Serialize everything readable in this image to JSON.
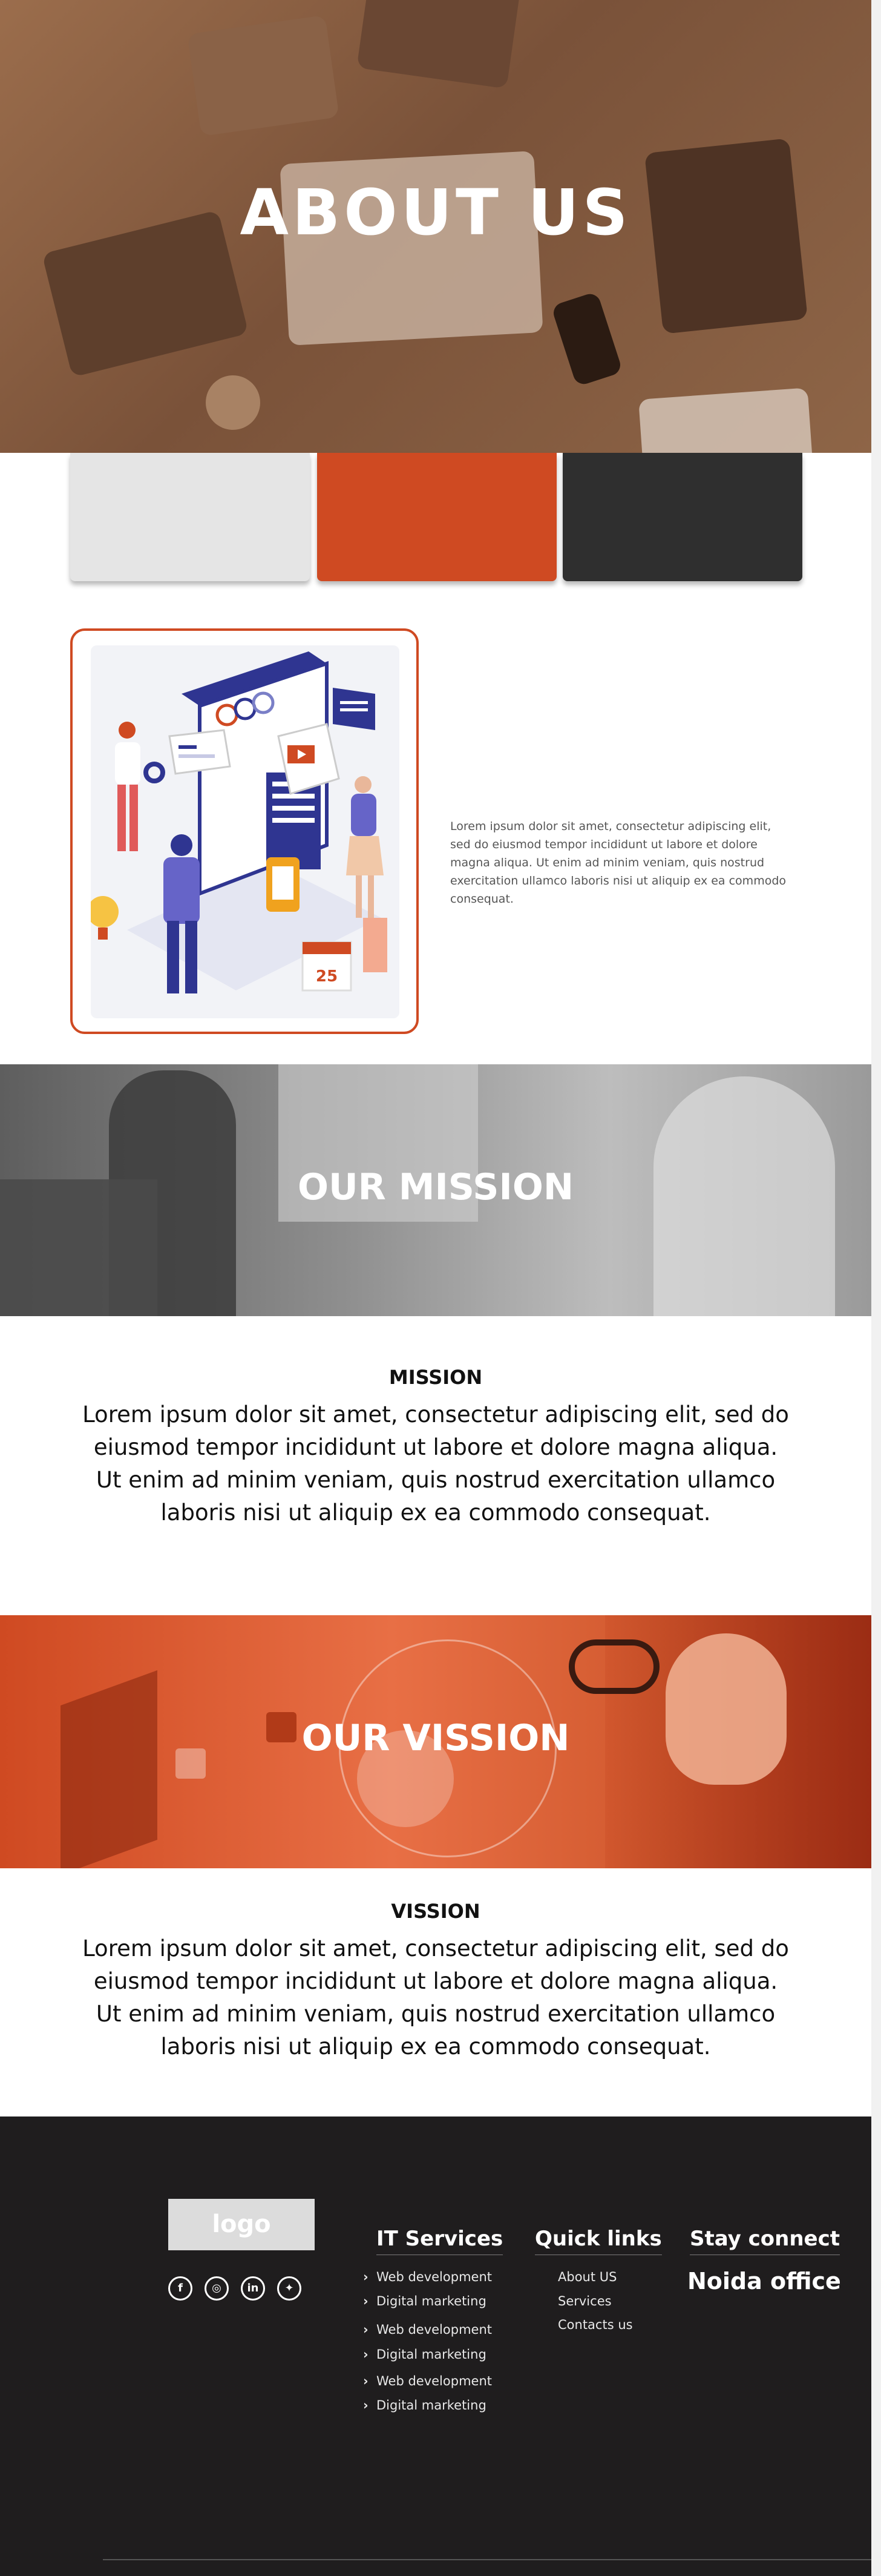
{
  "hero": {
    "title": "ABOUT US"
  },
  "cards": {
    "colors": [
      "#e5e5e5",
      "#cf4a22",
      "#2f2f2f"
    ]
  },
  "intro": {
    "text": "Lorem ipsum dolor sit amet, consectetur adipiscing elit, sed do eiusmod tempor incididunt ut labore et dolore magna aliqua. Ut enim ad minim veniam, quis nostrud exercitation ullamco laboris nisi ut aliquip ex ea  commodo consequat.",
    "calendar_number": "25"
  },
  "mission": {
    "banner_title": "OUR MISSION",
    "heading": "MISSION",
    "body": "Lorem ipsum dolor sit amet, consectetur adipiscing elit, sed do eiusmod tempor incididunt ut labore et dolore magna aliqua. Ut enim ad minim veniam, quis nostrud exercitation ullamco laboris nisi ut aliquip ex ea commodo consequat."
  },
  "vission": {
    "banner_title": "OUR VISSION",
    "heading": "VISSION",
    "body": "Lorem ipsum dolor sit amet, consectetur adipiscing elit, sed do eiusmod tempor incididunt ut labore et dolore magna aliqua. Ut enim ad minim veniam, quis nostrud exercitation ullamco laboris nisi ut aliquip ex ea commodo consequat."
  },
  "footer": {
    "logo": "logo",
    "social_icons": [
      "facebook-icon",
      "instagram-icon",
      "linkedin-icon",
      "twitter-icon"
    ],
    "it_services": {
      "heading": "IT Services",
      "items": [
        "Web development",
        "Digital marketing",
        "Web development",
        "Digital marketing",
        "Web development",
        "Digital marketing"
      ]
    },
    "quick_links": {
      "heading": "Quick links",
      "items": [
        "About US",
        "Services",
        "Contacts us"
      ]
    },
    "stay_connect": {
      "heading": "Stay connect",
      "office": "Noida office"
    }
  },
  "colors": {
    "accent": "#cf4a22",
    "dark": "#2f2f2f",
    "footer_bg": "#1f1d1e"
  }
}
